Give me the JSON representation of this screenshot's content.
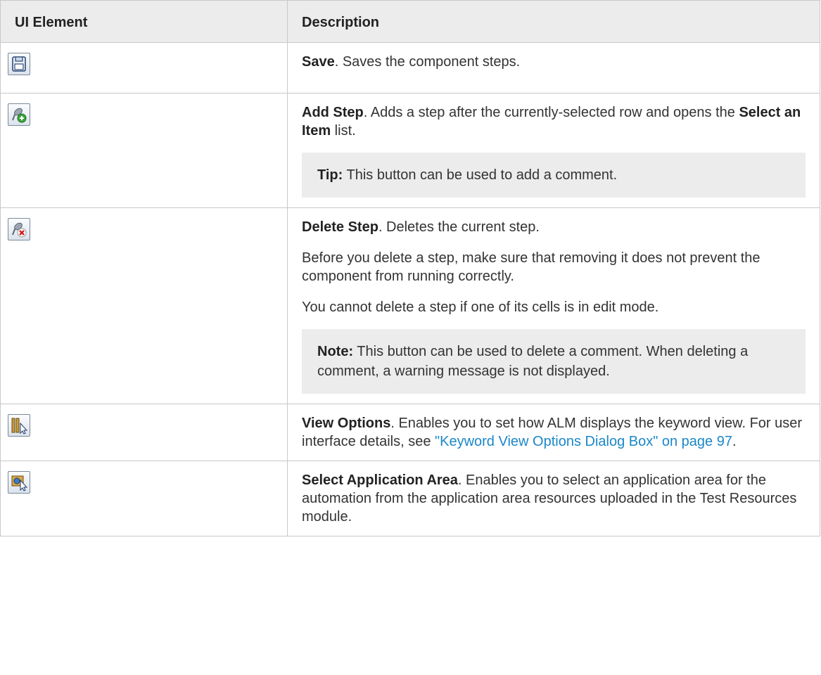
{
  "table": {
    "headers": {
      "element": "UI Element",
      "description": "Description"
    },
    "rows": [
      {
        "icon": "save-disk-icon",
        "title": "Save",
        "text": ". Saves the component steps."
      },
      {
        "icon": "add-step-icon",
        "title": "Add Step",
        "text_before": ". Adds a step after the currently-selected row and opens the ",
        "bold_mid": "Select an Item",
        "text_after": " list.",
        "tip_label": "Tip:",
        "tip_text": " This button can be used to add a comment."
      },
      {
        "icon": "delete-step-icon",
        "title": "Delete Step",
        "text": ". Deletes the current step.",
        "para2": "Before you delete a step, make sure that removing it does not prevent the component from running correctly.",
        "para3": "You cannot delete a step if one of its cells is in edit mode.",
        "note_label": "Note:",
        "note_text": " This button can be used to delete a comment. When deleting a comment, a warning message is not displayed."
      },
      {
        "icon": "view-options-icon",
        "title": "View Options",
        "text": ". Enables you to set how ALM displays the keyword view. For user interface details, see ",
        "link_text": "\"Keyword View Options Dialog Box\" on page 97",
        "text_end": "."
      },
      {
        "icon": "select-application-area-icon",
        "title": "Select Application Area",
        "text": ". Enables you to select an application area for the automation from the application area resources uploaded in the Test Resources module."
      }
    ]
  },
  "colors": {
    "header_bg": "#ececec",
    "callout_bg": "#ececec",
    "link": "#1a87c9",
    "border": "#c8c8c8"
  }
}
